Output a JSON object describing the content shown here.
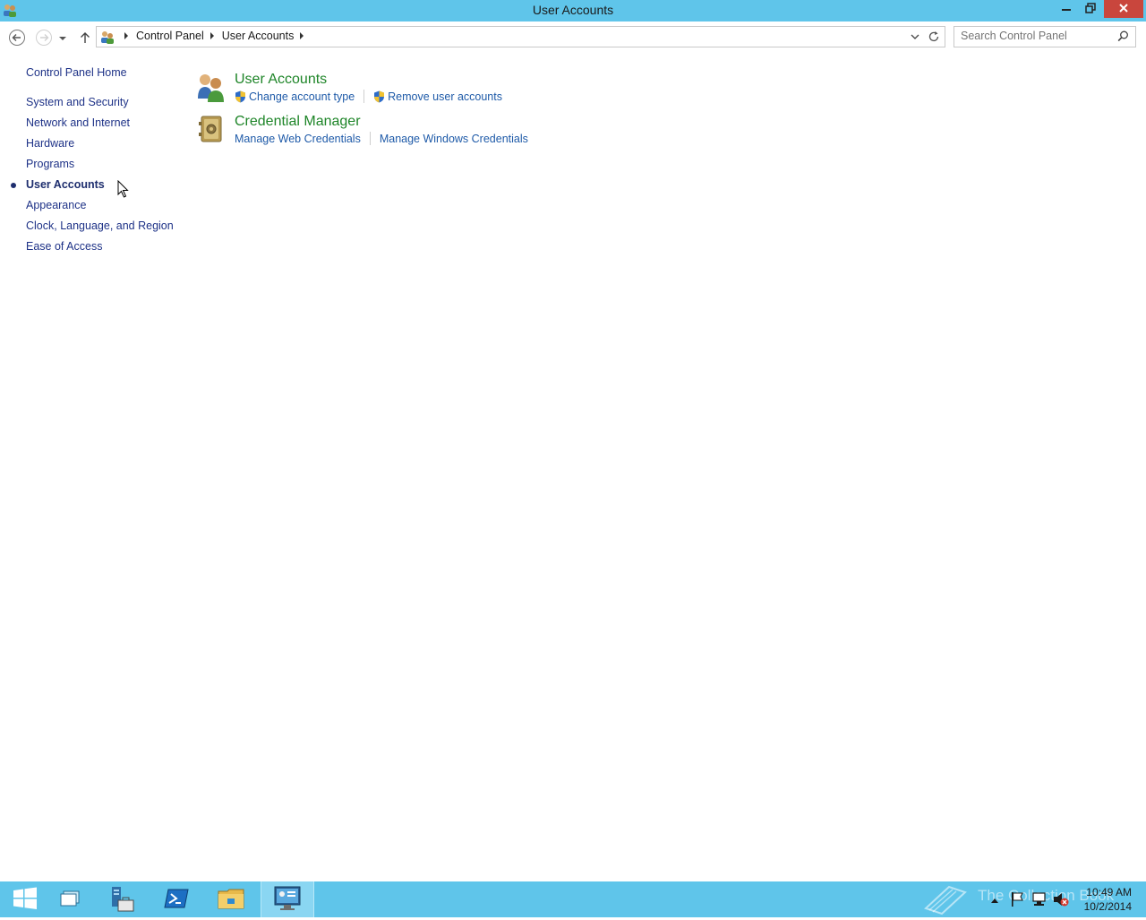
{
  "window": {
    "title": "User Accounts",
    "app_icon": "users-icon",
    "controls": [
      "minimize-icon",
      "restore-icon",
      "close-icon"
    ]
  },
  "navigation": {
    "back": "back-arrow-icon",
    "forward": "forward-arrow-icon",
    "recent": "chevron-down-icon",
    "up": "up-arrow-icon"
  },
  "address": {
    "icon": "control-panel-icon",
    "breadcrumbs": [
      "Control Panel",
      "User Accounts"
    ],
    "refresh_icon": "refresh-icon"
  },
  "search": {
    "placeholder": "Search Control Panel",
    "icon": "search-icon"
  },
  "sidebar": {
    "home": "Control Panel Home",
    "items": [
      {
        "label": "System and Security"
      },
      {
        "label": "Network and Internet"
      },
      {
        "label": "Hardware"
      },
      {
        "label": "Programs"
      },
      {
        "label": "User Accounts",
        "current": true
      },
      {
        "label": "Appearance"
      },
      {
        "label": "Clock, Language, and Region"
      },
      {
        "label": "Ease of Access"
      }
    ]
  },
  "categories": [
    {
      "title": "User Accounts",
      "icon": "users-icon",
      "links": [
        {
          "label": "Change account type",
          "shield": true
        },
        {
          "label": "Remove user accounts",
          "shield": true
        }
      ]
    },
    {
      "title": "Credential Manager",
      "icon": "credential-vault-icon",
      "links": [
        {
          "label": "Manage Web Credentials",
          "shield": false
        },
        {
          "label": "Manage Windows Credentials",
          "shield": false
        }
      ]
    }
  ],
  "taskbar": {
    "buttons": [
      "windows-start-icon",
      "task-view-icon",
      "server-manager-icon",
      "powershell-icon",
      "file-explorer-icon",
      "control-panel-icon"
    ],
    "watermark": "The Collection Book",
    "tray_icons": [
      "show-hidden-icons-icon",
      "action-center-flag-icon",
      "network-icon",
      "volume-muted-icon"
    ],
    "clock_time": "10:49 AM",
    "clock_date": "10/2/2014"
  },
  "colors": {
    "titlebar": "#5fc5ea",
    "link": "#1e5aa8",
    "category_title": "#1e8528",
    "sidebar_link": "#1e3287"
  }
}
